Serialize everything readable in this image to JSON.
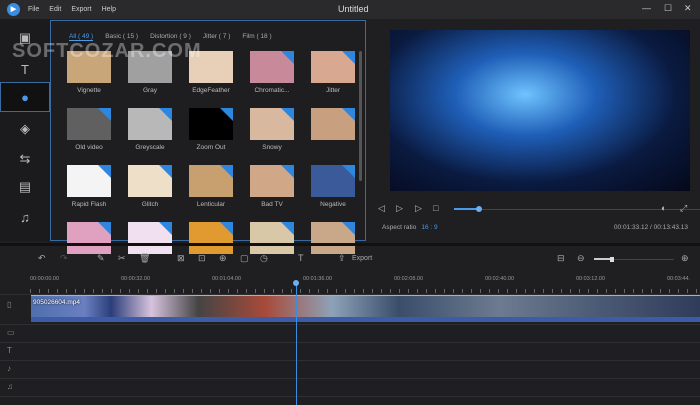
{
  "app": {
    "title": "Untitled",
    "logo": "app-logo",
    "menu": [
      "File",
      "Edit",
      "Export",
      "Help"
    ]
  },
  "effects": {
    "tabs": [
      "All ( 49 )",
      "Basic ( 15 )",
      "Distortion ( 9 )",
      "Jitter ( 7 )",
      "Film ( 18 )"
    ],
    "items": [
      {
        "label": "Vignette",
        "bg": "#c9a57a"
      },
      {
        "label": "Gray",
        "bg": "#a0a0a0"
      },
      {
        "label": "EdgeFeather",
        "bg": "#e8d0b8"
      },
      {
        "label": "Chromatic...",
        "bg": "#c88a9a"
      },
      {
        "label": "Jitter",
        "bg": "#d8a890"
      },
      {
        "label": "Old video",
        "bg": "#606060"
      },
      {
        "label": "Greyscale",
        "bg": "#b8b8b8"
      },
      {
        "label": "Zoom Out",
        "bg": "#000000"
      },
      {
        "label": "Snowy",
        "bg": "#d9b8a0"
      },
      {
        "label": "",
        "bg": "#c8a080"
      },
      {
        "label": "Rapid Flash",
        "bg": "#f4f4f4"
      },
      {
        "label": "Glitch",
        "bg": "#eee0c8"
      },
      {
        "label": "Lenticular",
        "bg": "#c8a070"
      },
      {
        "label": "Bad TV",
        "bg": "#d0a888"
      },
      {
        "label": "Negative",
        "bg": "#3a5a9a"
      },
      {
        "label": "",
        "bg": "#e0a0c0"
      },
      {
        "label": "",
        "bg": "#f0e0f0"
      },
      {
        "label": "",
        "bg": "#e09a30"
      },
      {
        "label": "",
        "bg": "#d8c8a8"
      },
      {
        "label": "",
        "bg": "#c8a888"
      }
    ]
  },
  "player": {
    "aspect_label": "Aspect ratio",
    "aspect_value": "16 : 9",
    "time": "00:01:33.12 / 00:13:43.13",
    "progress": 0.1
  },
  "toolbar": {
    "export_label": "Export",
    "zoom": 0.22
  },
  "timeline": {
    "ticks": [
      "00:00:00.00",
      "00:00:32.00",
      "00:01:04.00",
      "00:01:36.00",
      "00:02:08.00",
      "00:02:40.00",
      "00:03:12.00",
      "00:03:44."
    ],
    "clip_name": "905026604.mp4"
  },
  "watermark": "SOFTCOZAR.COM"
}
